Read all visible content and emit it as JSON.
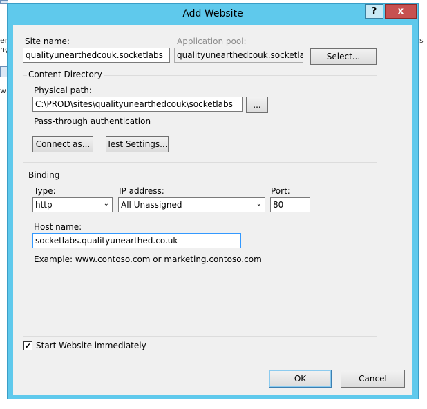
{
  "background": {
    "fragments": [
      "er",
      "ng",
      "wri",
      "s"
    ]
  },
  "dialog": {
    "title": "Add Website",
    "help_label": "?",
    "close_label": "x"
  },
  "site": {
    "site_name_label": "Site name:",
    "site_name_value": "qualityunearthedcouk.socketlabs",
    "app_pool_label": "Application pool:",
    "app_pool_value": "qualityunearthedcouk.socketlabs",
    "select_button": "Select..."
  },
  "content_directory": {
    "group_title": "Content Directory",
    "physical_path_label": "Physical path:",
    "physical_path_value": "C:\\PROD\\sites\\qualityunearthedcouk\\socketlabs",
    "browse_button": "...",
    "passthrough_label": "Pass-through authentication",
    "connect_as_button": "Connect as...",
    "test_settings_button": "Test Settings..."
  },
  "binding": {
    "group_title": "Binding",
    "type_label": "Type:",
    "type_value": "http",
    "ip_label": "IP address:",
    "ip_value": "All Unassigned",
    "port_label": "Port:",
    "port_value": "80",
    "host_name_label": "Host name:",
    "host_name_value": "socketlabs.qualityunearthed.co.uk",
    "example_text": "Example: www.contoso.com or marketing.contoso.com"
  },
  "start_immediately": {
    "label": "Start Website immediately",
    "checked": true,
    "check_glyph": "✔"
  },
  "footer": {
    "ok_button": "OK",
    "cancel_button": "Cancel"
  },
  "colors": {
    "title_bar": "#5fc9ec",
    "close_button": "#c75050"
  }
}
